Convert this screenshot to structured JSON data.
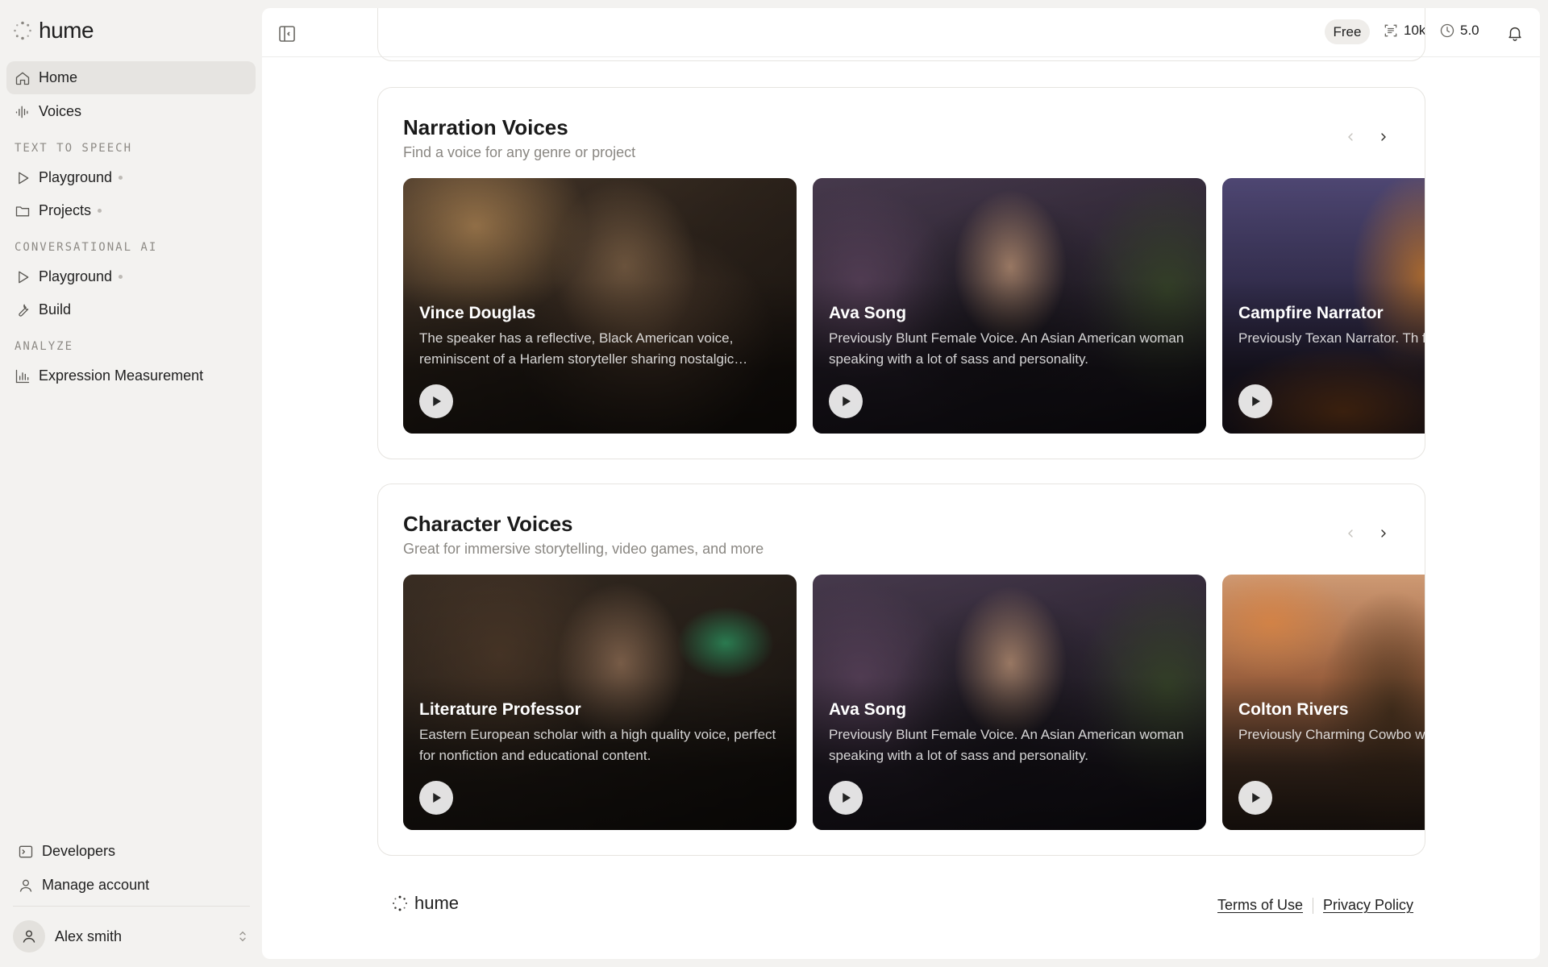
{
  "app": {
    "logo_text": "hume"
  },
  "sidebar": {
    "home": "Home",
    "voices": "Voices",
    "tts_label": "TEXT TO SPEECH",
    "tts_playground": "Playground",
    "tts_projects": "Projects",
    "conv_label": "CONVERSATIONAL AI",
    "conv_playground": "Playground",
    "build": "Build",
    "analyze_label": "ANALYZE",
    "expression": "Expression Measurement",
    "developers": "Developers",
    "manage_account": "Manage account",
    "user_name": "Alex smith"
  },
  "topbar": {
    "plan": "Free",
    "characters": "10k",
    "credits": "5.0"
  },
  "narration": {
    "title": "Narration Voices",
    "subtitle": "Find a voice for any genre or project",
    "cards": [
      {
        "name": "Vince Douglas",
        "desc": "The speaker has a reflective, Black American voice, reminiscent of a Harlem storyteller sharing nostalgic memories."
      },
      {
        "name": "Ava Song",
        "desc": "Previously Blunt Female Voice. An Asian American woman speaking with a lot of sass and personality."
      },
      {
        "name": "Campfire Narrator",
        "desc": "Previously Texan Narrator. Th famous audiobook narrator c"
      }
    ]
  },
  "character": {
    "title": "Character Voices",
    "subtitle": "Great for immersive storytelling, video games, and more",
    "cards": [
      {
        "name": "Literature Professor",
        "desc": "Eastern European scholar with a high quality voice, perfect for nonfiction and educational content."
      },
      {
        "name": "Ava Song",
        "desc": "Previously Blunt Female Voice. An Asian American woman speaking with a lot of sass and personality."
      },
      {
        "name": "Colton Rivers",
        "desc": "Previously Charming Cowbo with a folksy Texan drawl Sou"
      }
    ]
  },
  "footer": {
    "logo_text": "hume",
    "terms": "Terms of Use",
    "privacy": "Privacy Policy"
  }
}
